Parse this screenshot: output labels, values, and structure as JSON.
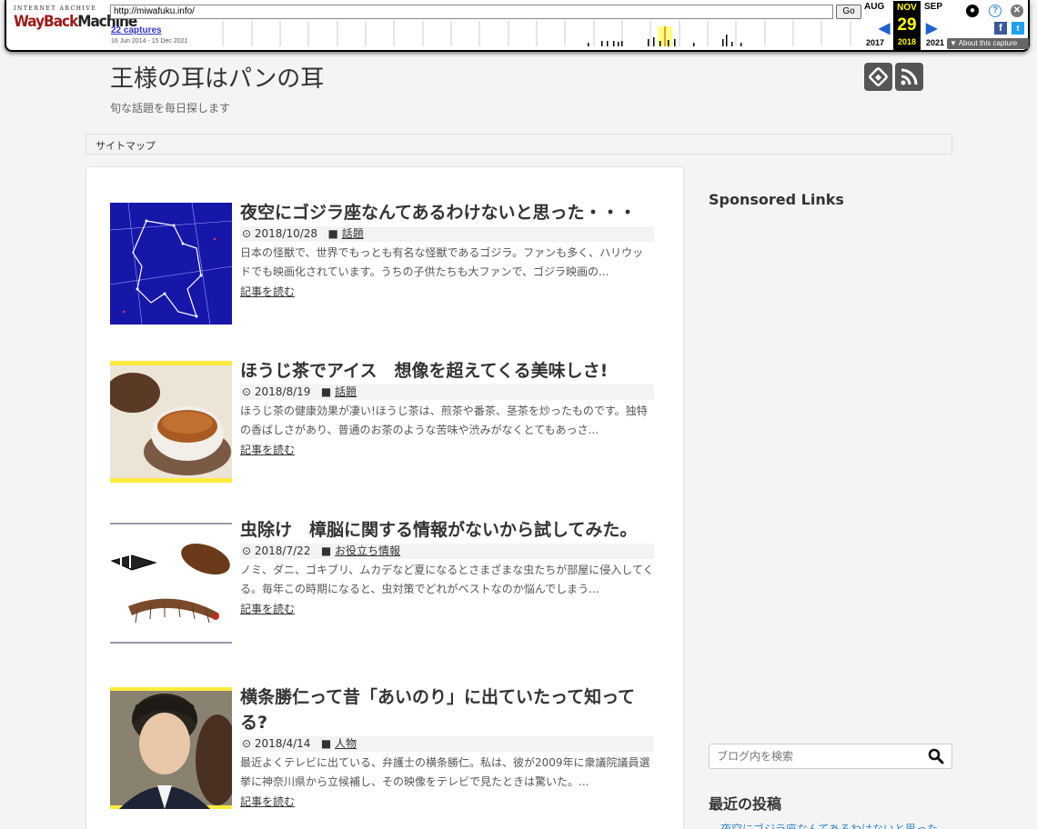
{
  "wayback": {
    "logo_top": "INTERNET ARCHIVE",
    "logo_a": "WayBack",
    "logo_b": "Machine",
    "url": "http://miwafuku.info/",
    "go_label": "Go",
    "captures": "22 captures",
    "date_range": "16 Jun 2014 - 15 Dec 2021",
    "prev_month": "AUG",
    "cur_month": "NOV",
    "next_month": "SEP",
    "cur_day": "29",
    "prev_year": "2017",
    "cur_year": "2018",
    "next_year": "2021",
    "about": "▼ About this capture"
  },
  "site": {
    "title": "王様の耳はパンの耳",
    "description": "旬な話題を毎日探します",
    "nav_sitemap": "サイトマップ"
  },
  "posts": [
    {
      "title": "夜空にゴジラ座なんてあるわけないと思った・・・",
      "date": "2018/10/28",
      "category": "話題",
      "excerpt": "日本の怪獣で、世界でもっとも有名な怪獣であるゴジラ。ファンも多く、ハリウッドでも映画化されています。うちの子供たちも大ファンで、ゴジラ映画の...",
      "more": "記事を読む"
    },
    {
      "title": "ほうじ茶でアイス　想像を超えてくる美味しさ!",
      "date": "2018/8/19",
      "category": "話題",
      "excerpt": "ほうじ茶の健康効果が凄い!ほうじ茶は、煎茶や番茶、茎茶を炒ったものです。独特の香ばしさがあり、普通のお茶のような苦味や渋みがなくとてもあっさ...",
      "more": "記事を読む"
    },
    {
      "title": "虫除け　樟脳に関する情報がないから試してみた。",
      "date": "2018/7/22",
      "category": "お役立ち情報",
      "excerpt": "ノミ、ダニ、ゴキブリ、ムカデなど夏になるとさまざまな虫たちが部屋に侵入してくる。毎年この時期になると、虫対策でどれがベストなのか悩んでしまう...",
      "more": "記事を読む"
    },
    {
      "title": "横条勝仁って昔「あいのり」に出ていたって知ってる?",
      "date": "2018/4/14",
      "category": "人物",
      "excerpt": "最近よくテレビに出ている、弁護士の横条勝仁。私は、彼が2009年に衆議院議員選挙に神奈川県から立候補し、その映像をテレビで見たときは驚いた。...",
      "more": "記事を読む"
    }
  ],
  "sidebar": {
    "sponsored": "Sponsored Links",
    "search_placeholder": "ブログ内を検索",
    "recent_heading": "最近の投稿",
    "recent_items": [
      "夜空にゴジラ座なんてあるわけないと思った"
    ]
  },
  "colors": {
    "accent_link": "#3a8ac9",
    "wayback_red": "#9e1915",
    "wayback_yellow": "#ffff00"
  }
}
